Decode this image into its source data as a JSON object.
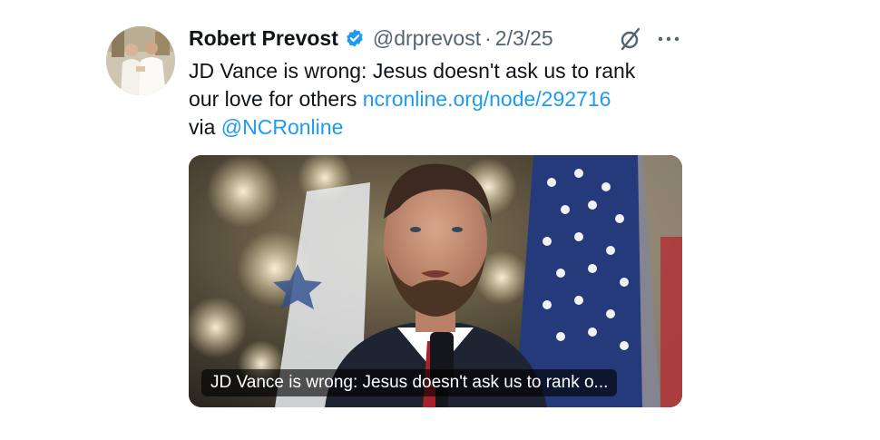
{
  "tweet": {
    "author_name": "Robert Prevost",
    "handle": "@drprevost",
    "separator": "·",
    "date": "2/3/25",
    "text_line1": "JD Vance is wrong: Jesus doesn't ask us to rank",
    "text_line2_prefix": "our love for others ",
    "link_text": "ncronline.org/node/292716",
    "text_line3_prefix": "via ",
    "mention": "@NCRonline",
    "card_caption": "JD Vance is wrong: Jesus doesn't ask us to rank o..."
  },
  "icons": {
    "verified": "verified-badge-icon",
    "grok": "grok-icon",
    "more": "more-options-icon"
  },
  "colors": {
    "link": "#1d9bf0",
    "verified": "#1d9bf0",
    "secondary_text": "#536471",
    "primary_text": "#0f1419"
  }
}
